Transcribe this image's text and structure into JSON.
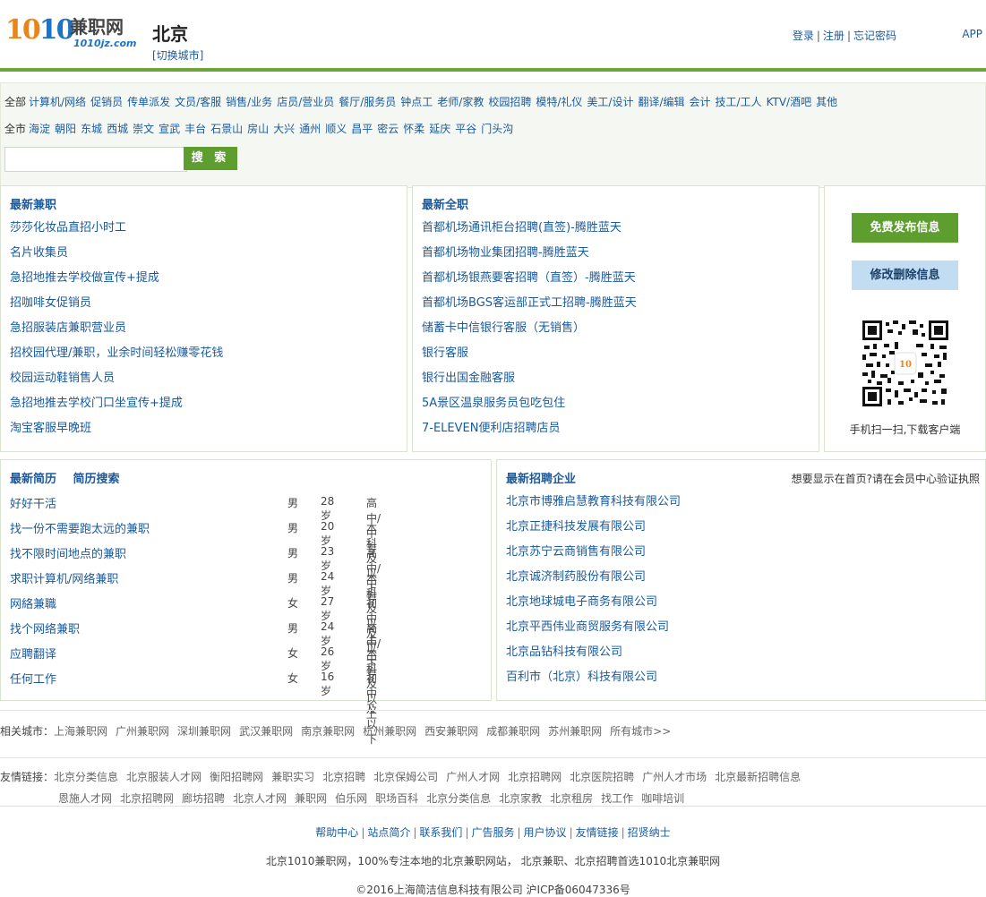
{
  "header": {
    "logo_number_a": "10",
    "logo_number_b": "10",
    "logo_name": "兼职网",
    "logo_domain": "1010jz.com",
    "city": "北京",
    "city_switch": "[切换城市]",
    "login": "登录",
    "register": "注册",
    "forgot": "忘记密码",
    "app": "APP"
  },
  "filter": {
    "categories_first": "全部",
    "categories": [
      "计算机/网络",
      "促销员",
      "传单派发",
      "文员/客服",
      "销售/业务",
      "店员/营业员",
      "餐厅/服务员",
      "钟点工",
      "老师/家教",
      "校园招聘",
      "模特/礼仪",
      "美工/设计",
      "翻译/编辑",
      "会计",
      "技工/工人",
      "KTV/酒吧",
      "其他"
    ],
    "districts_first": "全市",
    "districts": [
      "海淀",
      "朝阳",
      "东城",
      "西城",
      "崇文",
      "宣武",
      "丰台",
      "石景山",
      "房山",
      "大兴",
      "通州",
      "顺义",
      "昌平",
      "密云",
      "怀柔",
      "延庆",
      "平谷",
      "门头沟"
    ],
    "search_value": "",
    "search_button": "搜 索"
  },
  "latest_parttime": {
    "title": "最新兼职",
    "items": [
      "莎莎化妆品直招小时工",
      "名片收集员",
      "急招地推去学校做宣传+提成",
      "招咖啡女促销员",
      "急招服装店兼职营业员",
      "招校园代理/兼职，业余时间轻松赚零花钱",
      "校园运动鞋销售人员",
      "急招地推去学校门口坐宣传+提成",
      "淘宝客服早晚班"
    ]
  },
  "latest_fulltime": {
    "title": "最新全职",
    "items": [
      "首都机场通讯柜台招聘(直签)-腾胜蓝天",
      "首都机场物业集团招聘-腾胜蓝天",
      "首都机场银燕要客招聘（直签）-腾胜蓝天",
      "首都机场BGS客运部正式工招聘-腾胜蓝天",
      "储蓄卡中信银行客服（无销售）",
      "银行客服",
      "银行出国金融客服",
      "5A景区温泉服务员包吃包住",
      "7-ELEVEN便利店招聘店员"
    ]
  },
  "side": {
    "publish_button": "免费发布信息",
    "edit_button": "修改删除信息",
    "qr_caption": "手机扫一扫,下载客户端"
  },
  "resumes": {
    "title": "最新简历",
    "search_link": "简历搜索",
    "rows": [
      {
        "title": "好好干活",
        "gender": "男",
        "age": "28岁",
        "edu": "高中/中专"
      },
      {
        "title": "找一份不需要跑太远的兼职",
        "gender": "男",
        "age": "20岁",
        "edu": "本科及以上"
      },
      {
        "title": "找不限时间地点的兼职",
        "gender": "男",
        "age": "23岁",
        "edu": "高中/中专"
      },
      {
        "title": "求职计算机/网络兼职",
        "gender": "男",
        "age": "24岁",
        "edu": "本科及以上"
      },
      {
        "title": "网絡兼職",
        "gender": "女",
        "age": "27岁",
        "edu": "初中及以下"
      },
      {
        "title": "找个网络兼职",
        "gender": "男",
        "age": "24岁",
        "edu": "高中/中专"
      },
      {
        "title": "应聘翻译",
        "gender": "女",
        "age": "26岁",
        "edu": "本科及以上"
      },
      {
        "title": "任何工作",
        "gender": "女",
        "age": "16岁",
        "edu": "初中及以下"
      }
    ]
  },
  "enterprises": {
    "title": "最新招聘企业",
    "note": "想要显示在首页?请在会员中心验证执照",
    "items": [
      "北京市博雅启慧教育科技有限公司",
      "北京正捷科技发展有限公司",
      "北京苏宁云商销售有限公司",
      "北京诚济制药股份有限公司",
      "北京地球城电子商务有限公司",
      "北京平西伟业商贸服务有限公司",
      "北京品钻科技有限公司",
      "百利市（北京）科技有限公司"
    ]
  },
  "related": {
    "label": "相关城市：",
    "items": [
      "上海兼职网",
      "广州兼职网",
      "深圳兼职网",
      "武汉兼职网",
      "南京兼职网",
      "杭州兼职网",
      "西安兼职网",
      "成都兼职网",
      "苏州兼职网",
      "所有城市>>"
    ]
  },
  "friends": {
    "label": "友情链接：",
    "row1": [
      "北京分类信息",
      "北京服装人才网",
      "衡阳招聘网",
      "兼职实习",
      "北京招聘",
      "北京保姆公司",
      "广州人才网",
      "北京招聘网",
      "北京医院招聘",
      "广州人才市场",
      "北京最新招聘信息"
    ],
    "row2": [
      "恩施人才网",
      "北京招聘网",
      "廊坊招聘",
      "北京人才网",
      "兼职网",
      "伯乐网",
      "职场百科",
      "北京分类信息",
      "北京家教",
      "北京租房",
      "找工作",
      "咖啡培训"
    ]
  },
  "footer": {
    "links": [
      "帮助中心",
      "站点简介",
      "联系我们",
      "广告服务",
      "用户协议",
      "友情链接",
      "招贤纳士"
    ],
    "line2": "北京1010兼职网，100%专注本地的北京兼职网站， 北京兼职、北京招聘首选1010北京兼职网",
    "line3": "©2016上海简洁信息科技有限公司 沪ICP备06047336号"
  }
}
